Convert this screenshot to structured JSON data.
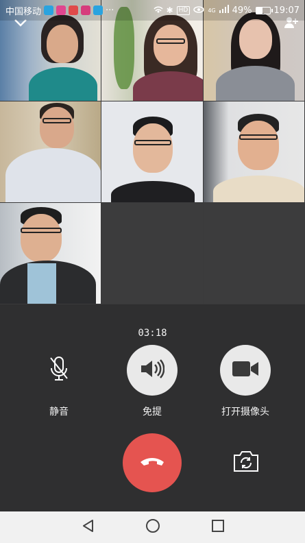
{
  "status_bar": {
    "carrier": "中国移动",
    "more_indicator": "···",
    "network_badge": "HD",
    "signal_label": "4G",
    "battery_percent": "49%",
    "time": "19:07"
  },
  "call": {
    "timer": "03:18",
    "controls": [
      {
        "id": "mute",
        "label": "静音",
        "icon": "microphone-off-icon"
      },
      {
        "id": "speaker",
        "label": "免提",
        "icon": "speaker-icon"
      },
      {
        "id": "camera",
        "label": "打开摄像头",
        "icon": "video-camera-icon"
      }
    ],
    "hangup_icon": "hang-up-icon",
    "switch_camera_icon": "switch-camera-icon"
  },
  "participants_count": 7,
  "colors": {
    "background": "#2f2f30",
    "hangup": "#e55450",
    "button_light": "#e9e9e9",
    "navbar": "#f1f1f1"
  },
  "nav": {
    "back": "back-icon",
    "home": "home-icon",
    "recents": "recents-icon"
  }
}
